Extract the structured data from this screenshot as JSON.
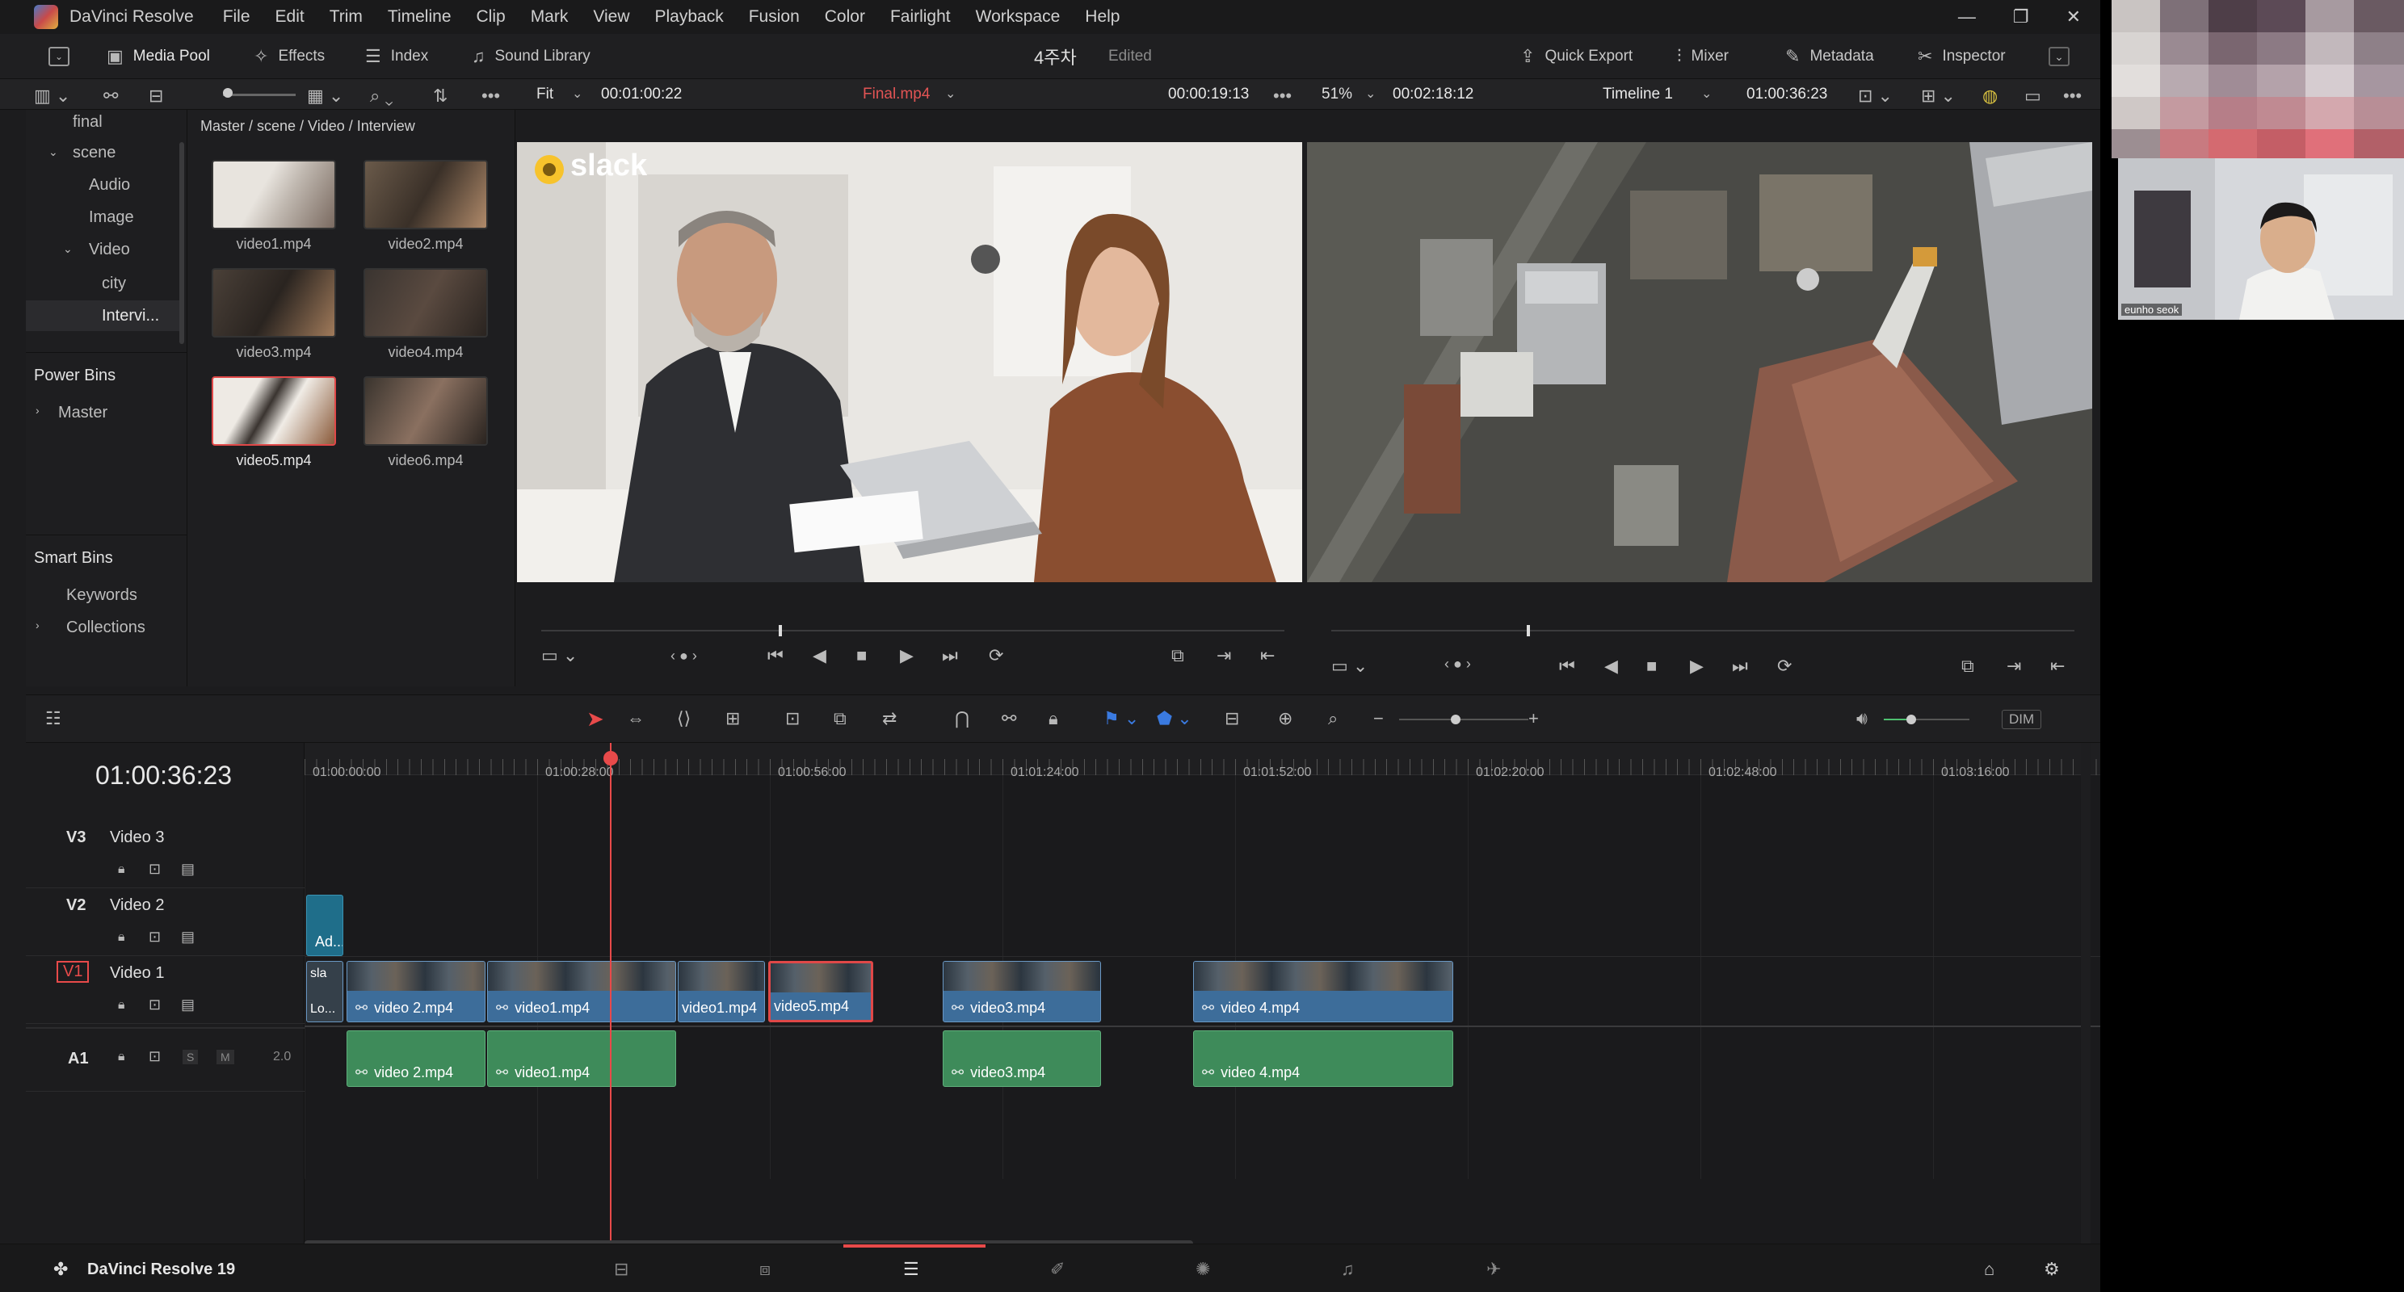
{
  "app": {
    "name": "DaVinci Resolve",
    "version_label": "DaVinci Resolve 19",
    "menu": [
      "File",
      "Edit",
      "Trim",
      "Timeline",
      "Clip",
      "Mark",
      "View",
      "Playback",
      "Fusion",
      "Color",
      "Fairlight",
      "Workspace",
      "Help"
    ]
  },
  "toolbar": {
    "media_pool": "Media Pool",
    "effects": "Effects",
    "index": "Index",
    "sound_library": "Sound Library",
    "project_title": "4주차",
    "project_status": "Edited",
    "quick_export": "Quick Export",
    "mixer": "Mixer",
    "metadata": "Metadata",
    "inspector": "Inspector"
  },
  "source_viewer": {
    "fit": "Fit",
    "timecode_in": "00:01:00:22",
    "clip_name": "Final.mp4",
    "timecode_dur": "00:00:19:13",
    "overlay_logo_text": "slack"
  },
  "timeline_viewer": {
    "zoom": "51%",
    "duration": "00:02:18:12",
    "timeline_name": "Timeline 1",
    "timecode": "01:00:36:23"
  },
  "bins": {
    "top_item": "final",
    "scene": "scene",
    "audio": "Audio",
    "image": "Image",
    "video": "Video",
    "city": "city",
    "interview": "Intervi...",
    "power_bins_title": "Power Bins",
    "power_master": "Master",
    "smart_bins_title": "Smart Bins",
    "keywords": "Keywords",
    "collections": "Collections"
  },
  "media_pool": {
    "breadcrumb": "Master / scene / Video / Interview",
    "clips": [
      "video1.mp4",
      "video2.mp4",
      "video3.mp4",
      "video4.mp4",
      "video5.mp4",
      "video6.mp4"
    ],
    "selected_index": 4
  },
  "timeline": {
    "current_timecode": "01:00:36:23",
    "ruler": [
      "01:00:00:00",
      "01:00:28:00",
      "01:00:56:00",
      "01:01:24:00",
      "01:01:52:00",
      "01:02:20:00",
      "01:02:48:00",
      "01:03:16:00"
    ],
    "tracks": {
      "v3": {
        "id": "V3",
        "name": "Video 3"
      },
      "v2": {
        "id": "V2",
        "name": "Video 2"
      },
      "v1": {
        "id": "V1",
        "name": "Video 1"
      },
      "a1": {
        "id": "A1",
        "channels": "2.0",
        "solo": "S",
        "mute": "M"
      }
    },
    "v2_clip": "Ad...",
    "v1_first_clip": {
      "top": "sla",
      "bottom": "Lo..."
    },
    "video_clips": [
      "video 2.mp4",
      "video1.mp4",
      "video1.mp4",
      "video5.mp4",
      "video3.mp4",
      "video 4.mp4"
    ],
    "audio_clips": [
      "video 2.mp4",
      "video1.mp4",
      "video3.mp4",
      "video 4.mp4"
    ],
    "dim": "DIM"
  },
  "webcam": {
    "name_label": "eunho seok"
  },
  "colors": {
    "accent_red": "#e04848",
    "clip_blue": "#3d6d9a",
    "clip_green": "#3e8b5a"
  }
}
